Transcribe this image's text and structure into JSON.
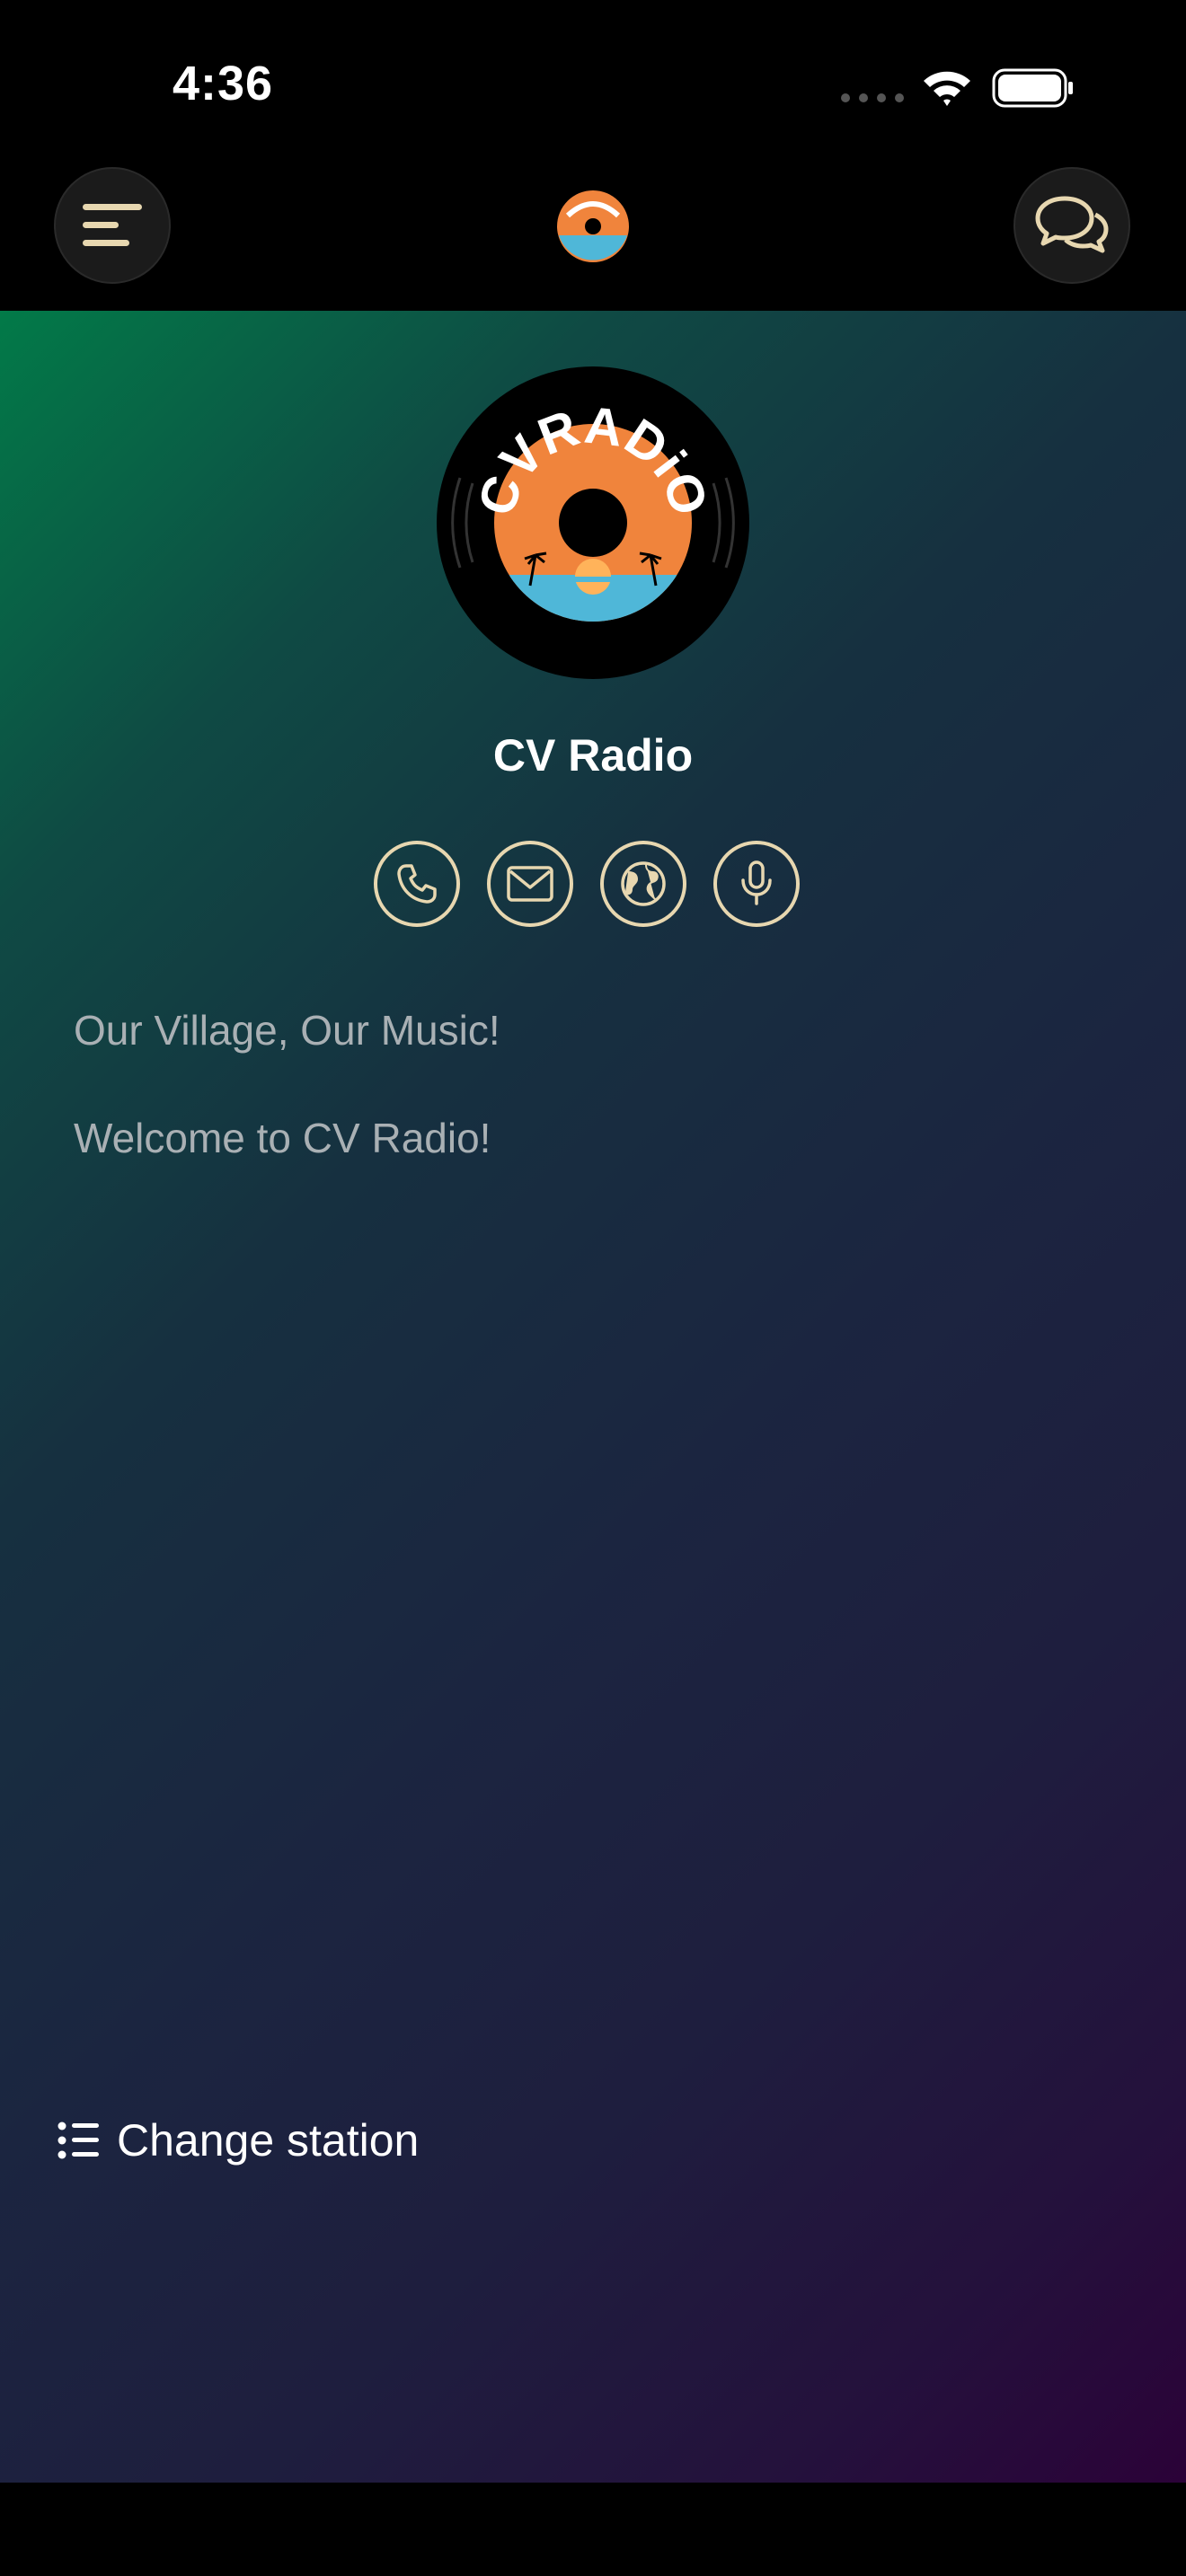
{
  "status_bar": {
    "time": "4:36"
  },
  "header": {
    "menu_icon": "menu-lines-icon",
    "logo_icon": "cv-radio-logo",
    "chat_icon": "chat-bubbles-icon"
  },
  "station": {
    "name": "CV Radio",
    "slogan": "Our Village, Our Music!",
    "welcome": "Welcome to CV Radio!",
    "logo_text": "CVRADiO"
  },
  "contacts": [
    {
      "icon": "phone-icon"
    },
    {
      "icon": "mail-icon"
    },
    {
      "icon": "globe-icon"
    },
    {
      "icon": "microphone-icon"
    }
  ],
  "footer": {
    "change_station_label": "Change station",
    "icon": "list-icon"
  },
  "colors": {
    "accent": "#e7d7b0",
    "gradient_start": "#027a48",
    "gradient_end": "#2b0238",
    "logo_orange": "#f0843c",
    "logo_blue": "#4fb7d8"
  }
}
